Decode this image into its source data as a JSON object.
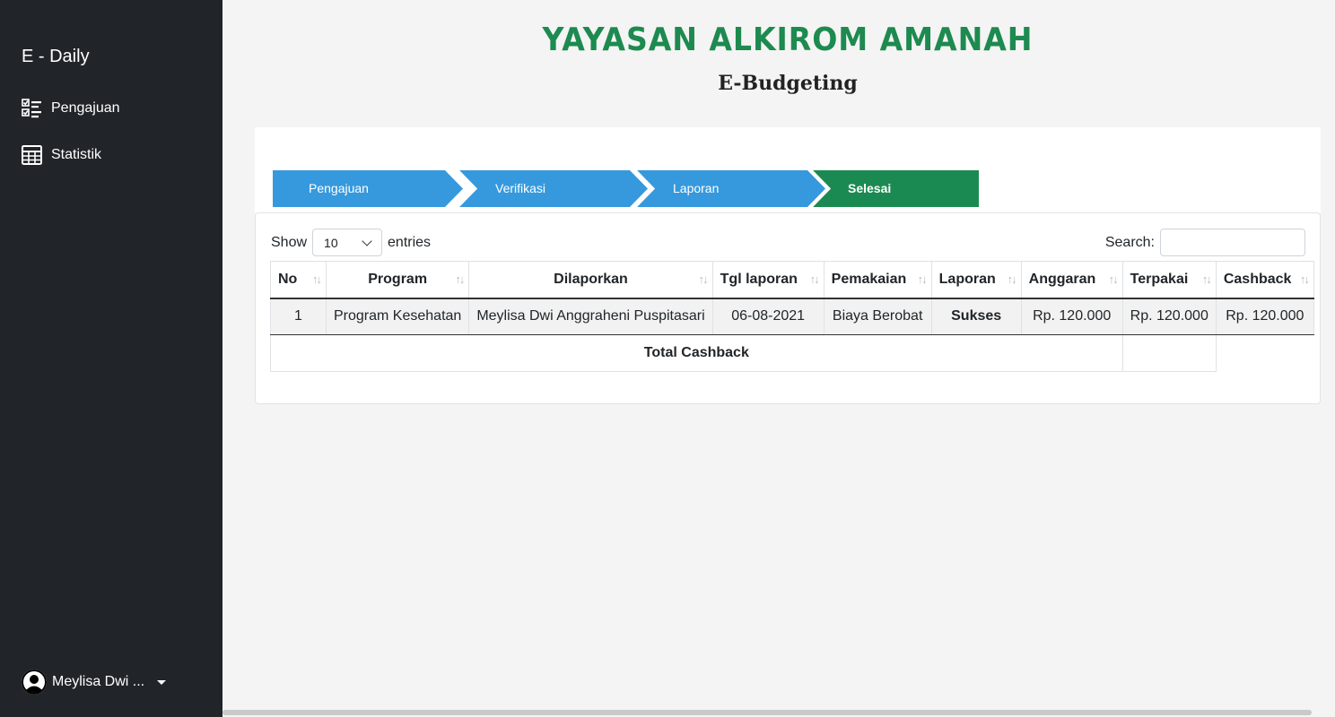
{
  "sidebar": {
    "brand": "E - Daily",
    "items": [
      {
        "label": "Pengajuan",
        "icon": "checklist-icon"
      },
      {
        "label": "Statistik",
        "icon": "table-icon"
      }
    ],
    "user": {
      "name": "Meylisa Dwi ...",
      "icon": "user-avatar-icon"
    }
  },
  "header": {
    "org_title": "YAYASAN ALKIROM AMANAH",
    "app_title": "E-Budgeting"
  },
  "steps": [
    {
      "label": "Pengajuan",
      "color": "#3699dd",
      "active": false
    },
    {
      "label": "Verifikasi",
      "color": "#3699dd",
      "active": false
    },
    {
      "label": "Laporan",
      "color": "#3699dd",
      "active": false
    },
    {
      "label": "Selesai",
      "color": "#1b8a52",
      "active": true
    }
  ],
  "table": {
    "show_label": "Show",
    "entries_value": "10",
    "entries_label": "entries",
    "search_label": "Search:",
    "columns": [
      "No",
      "Program",
      "Dilaporkan",
      "Tgl laporan",
      "Pemakaian",
      "Laporan",
      "Anggaran",
      "Terpakai",
      "Cashback"
    ],
    "rows": [
      [
        "1",
        "Program Kesehatan",
        "Meylisa Dwi Anggraheni Puspitasari",
        "06-08-2021",
        "Biaya Berobat",
        "Sukses",
        "Rp. 120.000",
        "Rp. 120.000",
        "Rp. 120.000"
      ]
    ],
    "footer_label": "Total Cashback"
  },
  "colors": {
    "sidebar": "#212529",
    "brand_green": "#1d8a4f",
    "step_blue": "#3699dd",
    "step_green": "#1b8a52"
  }
}
